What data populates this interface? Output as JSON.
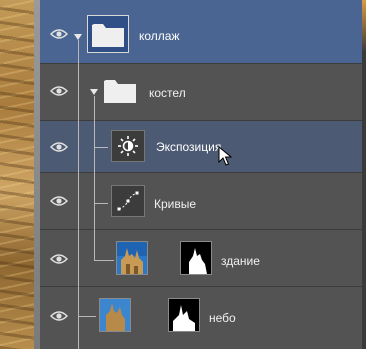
{
  "layers": [
    {
      "id": "group-collage",
      "name": "коллаж",
      "type": "group",
      "expanded": true,
      "visible": true,
      "selected": true
    },
    {
      "id": "group-kostel",
      "name": "костел",
      "type": "group",
      "expanded": true,
      "visible": true
    },
    {
      "id": "adj-exposure",
      "name": "Экспозиция",
      "type": "adjustment",
      "icon": "exposure-icon",
      "visible": true,
      "hovered": true
    },
    {
      "id": "adj-curves",
      "name": "Кривые",
      "type": "adjustment",
      "icon": "curves-icon",
      "visible": true
    },
    {
      "id": "layer-building",
      "name": "здание",
      "type": "image-with-mask",
      "visible": true
    },
    {
      "id": "layer-sky",
      "name": "небо",
      "type": "image-with-mask",
      "visible": true
    }
  ],
  "colors": {
    "panel": "#535353",
    "selected": "#4a6592",
    "hover": "#4d5a73"
  }
}
